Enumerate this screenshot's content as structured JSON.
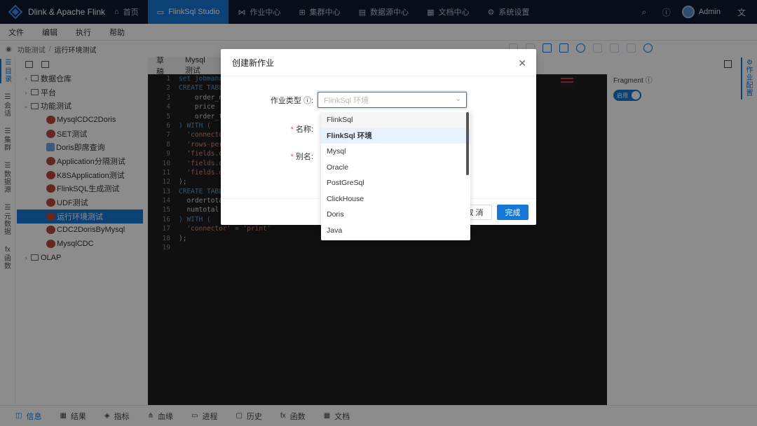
{
  "app": {
    "title": "Dlink & Apache Flink"
  },
  "nav": {
    "items": [
      {
        "label": "首页",
        "icon": "home-icon"
      },
      {
        "label": "FlinkSql Studio",
        "icon": "monitor-icon"
      },
      {
        "label": "作业中心",
        "icon": "share-icon"
      },
      {
        "label": "集群中心",
        "icon": "cluster-icon"
      },
      {
        "label": "数据源中心",
        "icon": "database-icon"
      },
      {
        "label": "文档中心",
        "icon": "document-icon"
      },
      {
        "label": "系统设置",
        "icon": "gear-icon"
      }
    ],
    "active_index": 1,
    "user": "Admin"
  },
  "menubar": [
    "文件",
    "编辑",
    "执行",
    "帮助"
  ],
  "breadcrumb": [
    "功能测试",
    "运行环境测试"
  ],
  "leftrail": [
    {
      "label": "目录"
    },
    {
      "label": "会话"
    },
    {
      "label": "集群"
    },
    {
      "label": "数据源"
    },
    {
      "label": "元数据"
    },
    {
      "label": "函数"
    }
  ],
  "tree": [
    {
      "label": "数据仓库",
      "type": "folder",
      "level": 0
    },
    {
      "label": "平台",
      "type": "folder",
      "level": 0
    },
    {
      "label": "功能测试",
      "type": "folder-open",
      "level": 0
    },
    {
      "label": "MysqlCDC2Doris",
      "type": "job",
      "level": 1
    },
    {
      "label": "SET测试",
      "type": "job",
      "level": 1
    },
    {
      "label": "Doris即席查询",
      "type": "doc",
      "level": 1
    },
    {
      "label": "Application分隔测试",
      "type": "job",
      "level": 1
    },
    {
      "label": "K8SApplication测试",
      "type": "job",
      "level": 1
    },
    {
      "label": "FlinkSQL生成测试",
      "type": "job",
      "level": 1
    },
    {
      "label": "UDF测试",
      "type": "job",
      "level": 1
    },
    {
      "label": "运行环境测试",
      "type": "job",
      "level": 1,
      "selected": true
    },
    {
      "label": "CDC2DorisByMysql",
      "type": "job",
      "level": 1
    },
    {
      "label": "MysqlCDC",
      "type": "job",
      "level": 1
    },
    {
      "label": "OLAP",
      "type": "folder",
      "level": 0
    }
  ],
  "editor": {
    "tabs": [
      "草稿",
      "Mysql测试"
    ],
    "line_numbers": [
      "1",
      "2",
      "3",
      "4",
      "5",
      "6",
      "7",
      "8",
      "9",
      "10",
      "11",
      "12",
      "13",
      "14",
      "15",
      "16",
      "17",
      "18",
      "19"
    ],
    "lines": [
      "set jobmana",
      "CREATE TABL",
      "    order_n",
      "    price",
      "    order_t",
      ") WITH (",
      "  'connecto",
      "  'rows-per",
      "  'fields.o",
      "  'fields.o",
      "  'fields.o",
      ");",
      "CREATE TABL",
      "  ordertota",
      "  numtotal",
      ") WITH (",
      "  'connector' = 'print'",
      ");",
      ""
    ]
  },
  "rightpanel": {
    "label": "Fragment",
    "toggle": "启用",
    "tab": "作业配置"
  },
  "bottombar": [
    {
      "label": "信息",
      "icon": "info-icon"
    },
    {
      "label": "结果",
      "icon": "table-icon"
    },
    {
      "label": "指标",
      "icon": "metric-icon"
    },
    {
      "label": "血缘",
      "icon": "lineage-icon"
    },
    {
      "label": "进程",
      "icon": "process-icon"
    },
    {
      "label": "历史",
      "icon": "history-icon"
    },
    {
      "label": "函数",
      "icon": "function-icon"
    },
    {
      "label": "文档",
      "icon": "document-icon"
    }
  ],
  "modal": {
    "title": "创建新作业",
    "type_label": "作业类型",
    "type_placeholder": "FlinkSql 环境",
    "name_label": "名称",
    "alias_label": "别名",
    "cancel": "取 消",
    "ok": "完成"
  },
  "dropdown": {
    "options": [
      "FlinkSql",
      "FlinkSql 环境",
      "Mysql",
      "Oracle",
      "PostGreSql",
      "ClickHouse",
      "Doris",
      "Java"
    ],
    "hover_index": 0,
    "selected_index": 1
  },
  "colors": {
    "primary": "#1677d6",
    "nav_bg": "#0d1b2f",
    "editor_bg": "#1e1e1e"
  }
}
